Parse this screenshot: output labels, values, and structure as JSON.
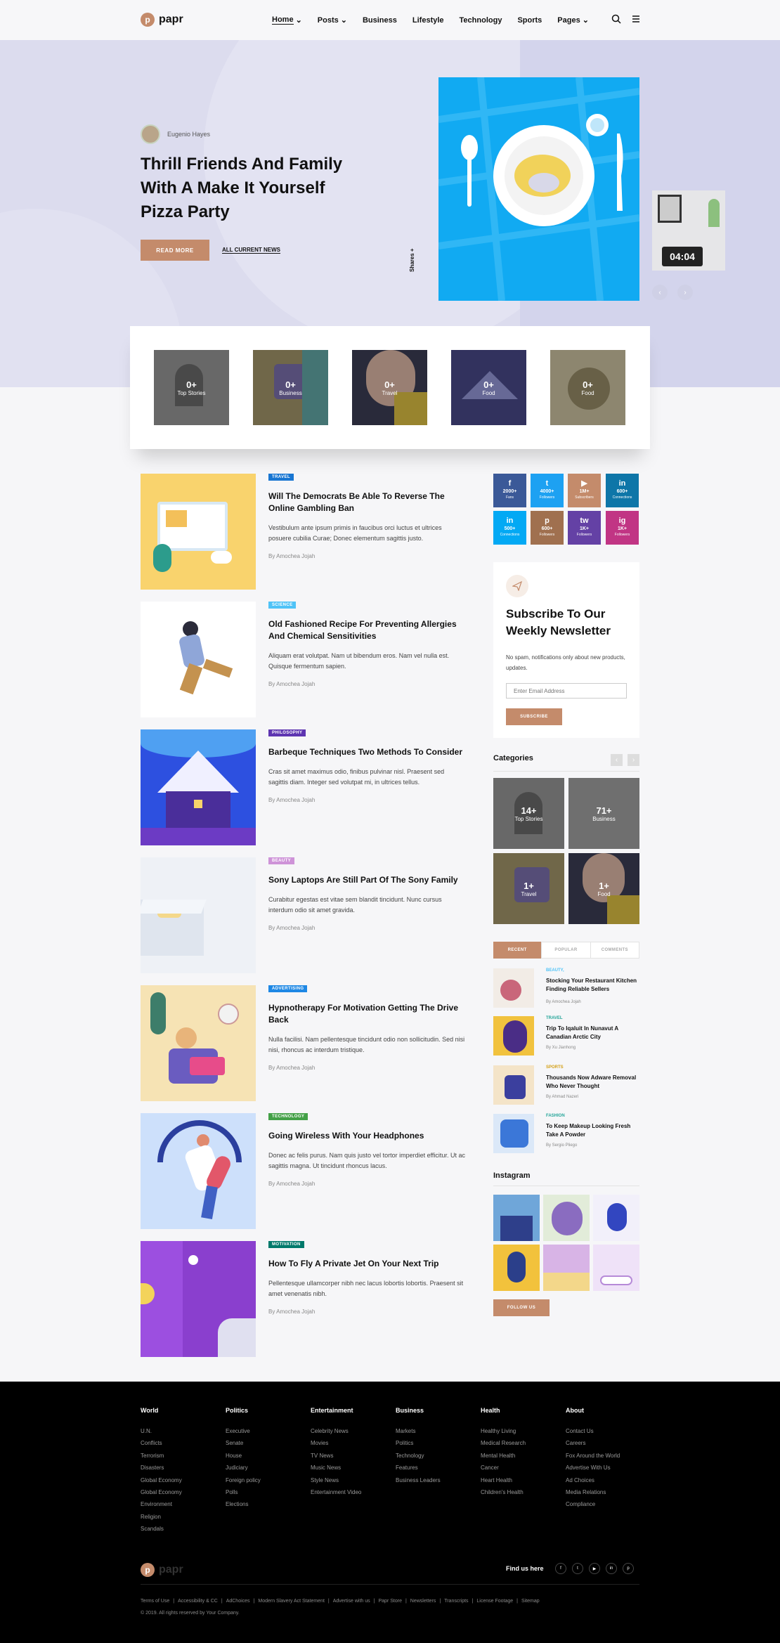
{
  "brand": {
    "name": "papr",
    "mark": "p"
  },
  "nav": {
    "items": [
      {
        "label": "Home",
        "dropdown": true,
        "active": true
      },
      {
        "label": "Posts",
        "dropdown": true
      },
      {
        "label": "Business"
      },
      {
        "label": "Lifestyle"
      },
      {
        "label": "Technology"
      },
      {
        "label": "Sports"
      },
      {
        "label": "Pages",
        "dropdown": true
      }
    ],
    "icons": [
      "search-icon",
      "hamburger-icon"
    ]
  },
  "hero": {
    "author": "Eugenio Hayes",
    "title": "Thrill Friends And Family With A Make It Yourself Pizza Party",
    "read_more": "READ MORE",
    "all_news": "ALL CURRENT NEWS",
    "shares": "Shares",
    "shares_icon": "+",
    "clock_text": "04:04"
  },
  "category_strip": [
    {
      "count": "0+",
      "label": "Top Stories"
    },
    {
      "count": "0+",
      "label": "Business"
    },
    {
      "count": "0+",
      "label": "Travel"
    },
    {
      "count": "0+",
      "label": "Food"
    },
    {
      "count": "0+",
      "label": "Food"
    }
  ],
  "articles": [
    {
      "tag": "TRAVEL",
      "tag_color": "#1976d2",
      "title": "Will The Democrats Be Able To Reverse The Online Gambling Ban",
      "excerpt": "Vestibulum ante ipsum primis in faucibus orci luctus et ultrices posuere cubilia Curae; Donec elementum sagittis justo.",
      "author": "By Amochea Jojah"
    },
    {
      "tag": "SCIENCE",
      "tag_color": "#4fc3f7",
      "title": "Old Fashioned Recipe For Preventing Allergies And Chemical Sensitivities",
      "excerpt": "Aliquam erat volutpat. Nam ut bibendum eros. Nam vel nulla est. Quisque fermentum sapien.",
      "author": "By Amochea Jojah"
    },
    {
      "tag": "PHILOSOPHY",
      "tag_color": "#5e35b1",
      "title": "Barbeque Techniques Two Methods To Consider",
      "excerpt": "Cras sit amet maximus odio, finibus pulvinar nisl. Praesent sed sagittis diam. Integer sed volutpat mi, in ultrices tellus.",
      "author": "By Amochea Jojah"
    },
    {
      "tag": "BEAUTY",
      "tag_color": "#ce93d8",
      "title": "Sony Laptops Are Still Part Of The Sony Family",
      "excerpt": "Curabitur egestas est vitae sem blandit tincidunt. Nunc cursus interdum odio sit amet gravida.",
      "author": "By Amochea Jojah"
    },
    {
      "tag": "ADVERTISING",
      "tag_color": "#1e88e5",
      "title": "Hypnotherapy For Motivation Getting The Drive Back",
      "excerpt": "Nulla facilisi. Nam pellentesque tincidunt odio non sollicitudin. Sed nisi nisi, rhoncus ac interdum tristique.",
      "author": "By Amochea Jojah"
    },
    {
      "tag": "TECHNOLOGY",
      "tag_color": "#43a047",
      "title": "Going Wireless With Your Headphones",
      "excerpt": "Donec ac felis purus. Nam quis justo vel tortor imperdiet efficitur. Ut ac sagittis magna. Ut tincidunt rhoncus lacus.",
      "author": "By Amochea Jojah"
    },
    {
      "tag": "MOTIVATION",
      "tag_color": "#00796b",
      "title": "How To Fly A Private Jet On Your Next Trip",
      "excerpt": "Pellentesque ullamcorper nibh nec lacus lobortis lobortis. Praesent sit amet venenatis nibh.",
      "author": "By Amochea Jojah"
    }
  ],
  "social": [
    {
      "icon": "f",
      "count": "2000+",
      "label": "Fans",
      "color": "#3b5998"
    },
    {
      "icon": "t",
      "count": "4000+",
      "label": "Followers",
      "color": "#1da1f2"
    },
    {
      "icon": "▶",
      "count": "1M+",
      "label": "Subscribers",
      "color": "#c48b6b"
    },
    {
      "icon": "in",
      "count": "600+",
      "label": "Connections",
      "color": "#0e76a8"
    },
    {
      "icon": "in",
      "count": "500+",
      "label": "Connections",
      "color": "#03a9f4"
    },
    {
      "icon": "p",
      "count": "600+",
      "label": "Followers",
      "color": "#a0704f"
    },
    {
      "icon": "tw",
      "count": "1K+",
      "label": "Followers",
      "color": "#6441a5"
    },
    {
      "icon": "ig",
      "count": "1K+",
      "label": "Followers",
      "color": "#c13584"
    }
  ],
  "newsletter": {
    "title": "Subscribe To Our Weekly Newsletter",
    "text": "No spam, notifications only about new products, updates.",
    "placeholder": "Enter Email Address",
    "button": "SUBSCRIBE"
  },
  "categories": {
    "title": "Categories",
    "items": [
      {
        "count": "14+",
        "label": "Top Stories"
      },
      {
        "count": "71+",
        "label": "Business"
      },
      {
        "count": "1+",
        "label": "Travel"
      },
      {
        "count": "1+",
        "label": "Food"
      }
    ]
  },
  "tabs": [
    "RECENT",
    "POPULAR",
    "COMMENTS"
  ],
  "recent": [
    {
      "cat": "BEAUTY,",
      "cat_color": "#4fc3f7",
      "title": "Stocking Your Restaurant Kitchen Finding Reliable Sellers",
      "author": "By Amochea Jojah"
    },
    {
      "cat": "TRAVEL",
      "cat_color": "#26a69a",
      "title": "Trip To Iqaluit In Nunavut A Canadian Arctic City",
      "author": "By Xu Jianhong"
    },
    {
      "cat": "SPORTS",
      "cat_color": "#d4a017",
      "title": "Thousands Now Adware Removal Who Never Thought",
      "author": "By Ahmad Nazeri"
    },
    {
      "cat": "FASHION",
      "cat_color": "#26a69a",
      "title": "To Keep Makeup Looking Fresh Take A Powder",
      "author": "By Sergio Pliego"
    }
  ],
  "instagram": {
    "title": "Instagram",
    "button": "FOLLOW US"
  },
  "footer": {
    "columns": [
      {
        "title": "World",
        "links": [
          "U.N.",
          "Conflicts",
          "Terrorism",
          "Disasters",
          "Global Economy",
          "Global Economy",
          "Environment",
          "Religion",
          "Scandals"
        ]
      },
      {
        "title": "Politics",
        "links": [
          "Executive",
          "Senate",
          "House",
          "Judiciary",
          "Foreign policy",
          "Polls",
          "Elections"
        ]
      },
      {
        "title": "Entertainment",
        "links": [
          "Celebrity News",
          "Movies",
          "TV News",
          "Music News",
          "Style News",
          "Entertainment Video"
        ]
      },
      {
        "title": "Business",
        "links": [
          "Markets",
          "Politics",
          "Technology",
          "Features",
          "Business Leaders"
        ]
      },
      {
        "title": "Health",
        "links": [
          "Healthy Living",
          "Medical Research",
          "Mental Health",
          "Cancer",
          "Heart Health",
          "Children's Health"
        ]
      },
      {
        "title": "About",
        "links": [
          "Contact Us",
          "Careers",
          "Fox Around the World",
          "Advertise With Us",
          "Ad Choices",
          "Media Relations",
          "Compliance"
        ]
      }
    ],
    "find_us": "Find us here",
    "social_icons": [
      "f",
      "t",
      "▶",
      "in",
      "p"
    ],
    "bottom_links": [
      "Terms of Use",
      "Accessibility & CC",
      "AdChoices",
      "Modern Slavery Act Statement",
      "Advertise with us",
      "Papr Store",
      "Newsletters",
      "Transcripts",
      "License Footage",
      "Sitemap"
    ],
    "copyright": "© 2019. All rights reserved by Your Company."
  }
}
